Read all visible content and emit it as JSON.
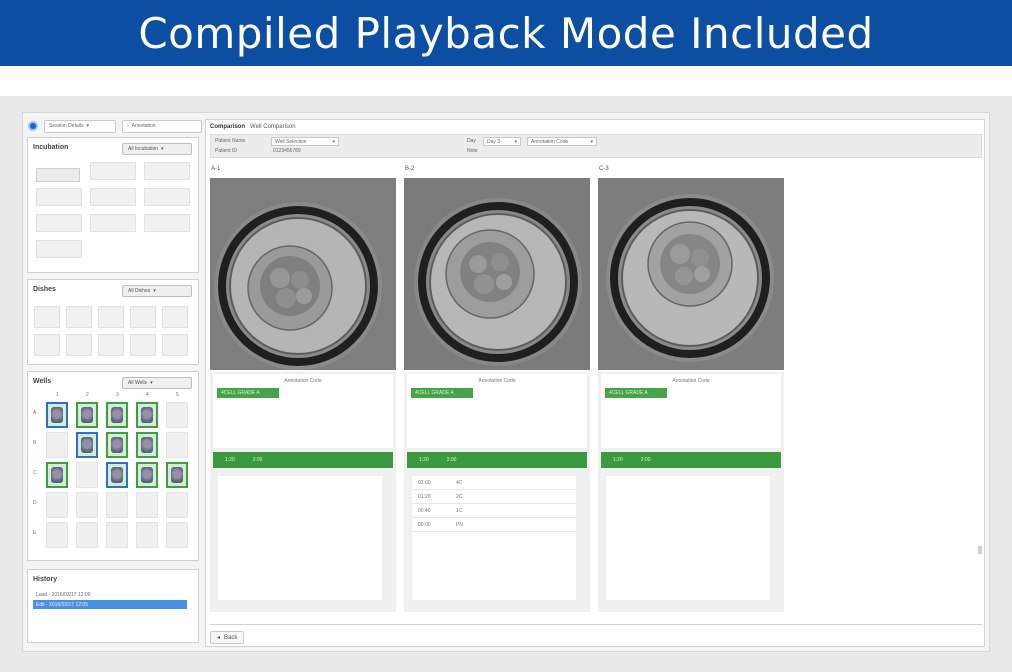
{
  "banner": {
    "title": "Compiled Playback Mode Included"
  },
  "top_controls": {
    "mode_select": "Session Details",
    "secondary_select": "Annotation"
  },
  "panels": {
    "incubation": {
      "title": "Incubation",
      "button": "All Incubation"
    },
    "dishes": {
      "title": "Dishes",
      "button": "All Dishes"
    },
    "wells": {
      "title": "Wells",
      "button": "All Wells",
      "col_labels": [
        "1",
        "2",
        "3",
        "4",
        "5"
      ],
      "row_labels": [
        "A",
        "B",
        "C",
        "D",
        "E"
      ]
    },
    "history": {
      "title": "History",
      "items": [
        "Load - 2016/03/17 12:00",
        "Edit - 2016/03/17 12:05"
      ]
    }
  },
  "main": {
    "tab": "Comparison",
    "tab_sub": "Well Comparison",
    "filter": {
      "label1": "Patient Name",
      "select1": "Well Selection",
      "label2": "Patient ID",
      "value2": "0123456789",
      "label3": "Day",
      "select3": "Day 3",
      "select4": "Annotation Code",
      "label4": "Note"
    },
    "wells": [
      {
        "label": "A-1",
        "panel_title": "Annotation Code",
        "tag": "4CELL GRADE A",
        "bar_left": "1:20",
        "bar_right": "2:00",
        "rows": []
      },
      {
        "label": "B-2",
        "panel_title": "Annotation Code",
        "tag": "4CELL GRADE A",
        "bar_left": "1:20",
        "bar_right": "2:00",
        "rows": [
          {
            "a": "02:00",
            "b": "4C"
          },
          {
            "a": "01:20",
            "b": "2C"
          },
          {
            "a": "00:40",
            "b": "1C"
          },
          {
            "a": "00:00",
            "b": "PN"
          }
        ]
      },
      {
        "label": "C-3",
        "panel_title": "Annotation Code",
        "tag": "4CELL GRADE A",
        "bar_left": "1:20",
        "bar_right": "2:00",
        "rows": []
      }
    ],
    "back_button": "Back"
  }
}
